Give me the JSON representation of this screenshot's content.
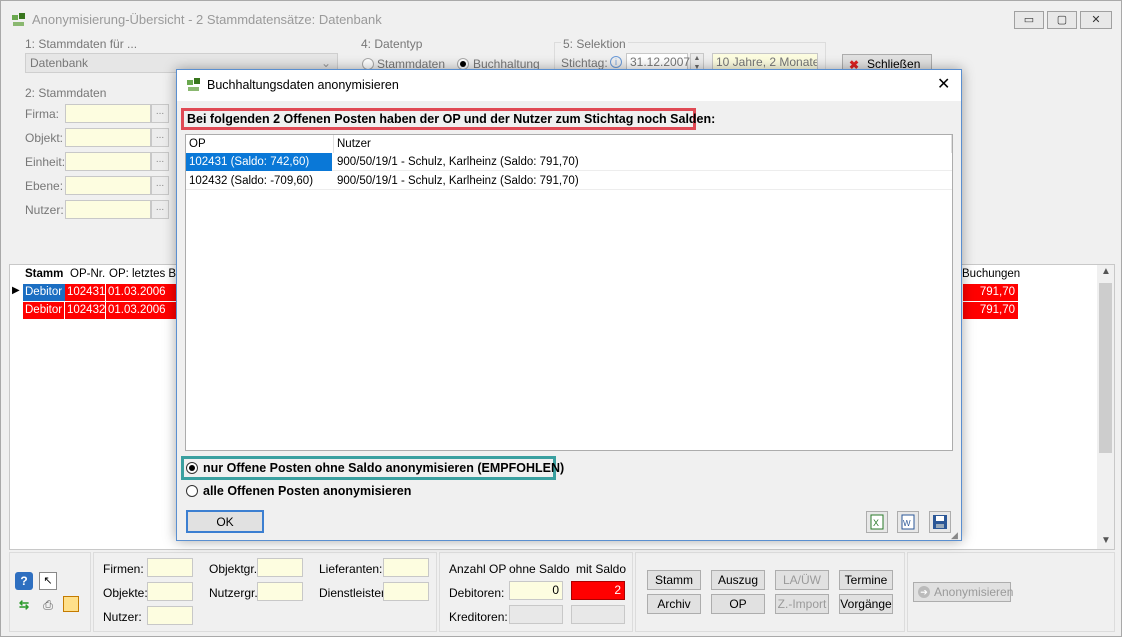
{
  "window": {
    "title": "Anonymisierung-Übersicht - 2 Stammdatensätze: Datenbank",
    "controls": [
      "▭",
      "▢",
      "✕"
    ]
  },
  "stammdaten_fuer": {
    "label": "1: Stammdaten für ...",
    "value": "Datenbank"
  },
  "datentyp": {
    "label": "4: Datentyp",
    "option1": "Stammdaten",
    "option2": "Buchhaltung"
  },
  "selektion": {
    "label": "5: Selektion",
    "stichtag_label": "Stichtag:",
    "stichtag_value": "31.12.2007",
    "range_value": "10 Jahre, 2 Monate u"
  },
  "close_button": "Schließen",
  "stammdaten": {
    "label": "2: Stammdaten",
    "fields": [
      "Firma:",
      "Objekt:",
      "Einheit:",
      "Ebene:",
      "Nutzer:"
    ],
    "dots": "..."
  },
  "grid": {
    "headers": [
      "Stamm",
      "OP-Nr.",
      "OP: letztes Be",
      "Buchungen"
    ],
    "rows": [
      {
        "stamm": "Debitor",
        "op": "102431",
        "date": "01.03.2006",
        "amount": "791,70"
      },
      {
        "stamm": "Debitor",
        "op": "102432",
        "date": "01.03.2006",
        "amount": "791,70"
      }
    ]
  },
  "bottom": {
    "firmen": "Firmen:",
    "objekte": "Objekte:",
    "nutzer": "Nutzer:",
    "objektgr": "Objektgr.:",
    "nutzergr": "Nutzergr.:",
    "lieferanten": "Lieferanten:",
    "dienstleister": "Dienstleister:",
    "anzahl_op": "Anzahl OP",
    "ohne_saldo": "ohne Saldo",
    "mit_saldo": "mit Saldo",
    "debitoren": "Debitoren:",
    "kreditoren": "Kreditoren:",
    "deb_ohne": "0",
    "deb_mit": "2",
    "buttons": {
      "stamm": "Stamm",
      "auszug": "Auszug",
      "la_uew": "LA/ÜW",
      "termine": "Termine",
      "archiv": "Archiv",
      "op": "OP",
      "z_import": "Z.-Import",
      "vorgaenge": "Vorgänge",
      "anonymisieren": "Anonymisieren"
    }
  },
  "dialog": {
    "title": "Buchhaltungsdaten anonymisieren",
    "message": "Bei folgenden 2 Offenen Posten haben der OP und der Nutzer zum Stichtag noch Salden:",
    "columns": [
      "OP",
      "Nutzer"
    ],
    "rows": [
      {
        "op": "102431  (Saldo: 742,60)",
        "nutzer": "900/50/19/1 - Schulz, Karlheinz  (Saldo: 791,70)"
      },
      {
        "op": "102432  (Saldo: -709,60)",
        "nutzer": "900/50/19/1 - Schulz, Karlheinz  (Saldo: 791,70)"
      }
    ],
    "option_recommended": "nur Offene Posten ohne Saldo anonymisieren (EMPFOHLEN)",
    "option_all": "alle Offenen Posten anonymisieren",
    "ok": "OK",
    "close": "✕"
  }
}
